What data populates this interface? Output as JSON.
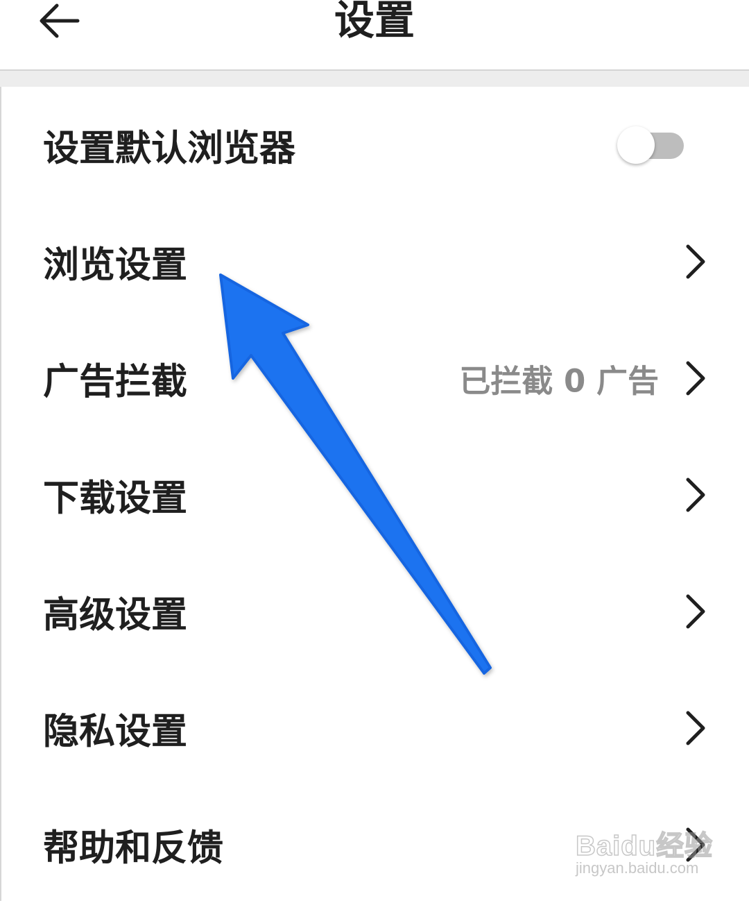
{
  "header": {
    "title": "设置",
    "back_icon": "arrow-left-icon"
  },
  "rows": [
    {
      "label": "设置默认浏览器",
      "control": "toggle",
      "toggle_on": false
    },
    {
      "label": "浏览设置",
      "control": "chevron"
    },
    {
      "label": "广告拦截",
      "value": "已拦截 0 广告",
      "control": "chevron"
    },
    {
      "label": "下载设置",
      "control": "chevron"
    },
    {
      "label": "高级设置",
      "control": "chevron"
    },
    {
      "label": "隐私设置",
      "control": "chevron"
    },
    {
      "label": "帮助和反馈",
      "control": "chevron"
    }
  ],
  "annotation": {
    "type": "arrow",
    "color": "#1e73f0",
    "points_to": "浏览设置"
  },
  "watermark": {
    "brand": "Baidu经验",
    "url": "jingyan.baidu.com"
  },
  "colors": {
    "text_primary": "#1f1f1f",
    "text_secondary": "#8a8a8a",
    "toggle_track_off": "#bdbdbd",
    "section_gap": "#ededed"
  }
}
